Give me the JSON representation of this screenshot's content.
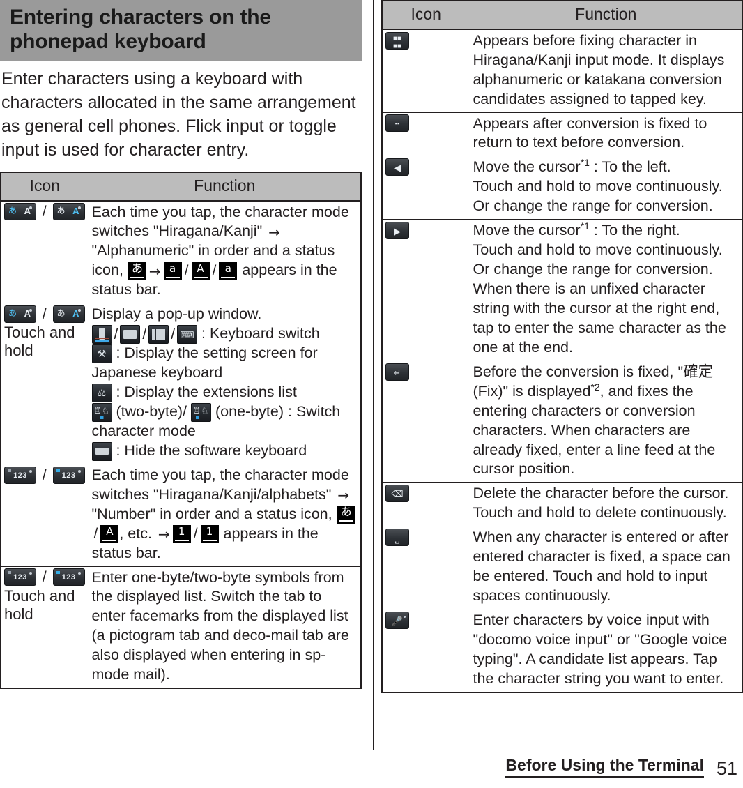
{
  "heading": "Entering characters on the phonepad keyboard",
  "intro": "Enter characters using a keyboard with characters allocated in the same arrangement as general cell phones. Flick input or toggle input is used for character entry.",
  "table_headers": {
    "icon": "Icon",
    "function": "Function"
  },
  "left_table": {
    "rows": [
      {
        "icon_label": "character-mode-key",
        "touch_and_hold": "",
        "text_1": "Each time you tap, the character mode switches \"Hiragana/Kanji\" ",
        "arrow_1": "→",
        "text_2": " \"Alphanumeric\" in order and a status icon, ",
        "status_1": "あ",
        "arrow_2": "→",
        "status_2": "a",
        "sep_1": "/",
        "status_3": "A",
        "sep_2": "/",
        "status_4": "a",
        "text_3": " appears in the status bar."
      },
      {
        "icon_label": "character-mode-key",
        "touch_and_hold": "Touch and hold",
        "line_1": "Display a pop-up window.",
        "line_2_suffix": ": Keyboard switch",
        "line_3_suffix": ": Display the setting screen for Japanese keyboard",
        "line_4_suffix": ": Display the extensions list",
        "line_5_a": "(two-byte)/",
        "line_5_b": "(one-byte) : Switch character mode",
        "line_6_suffix": ": Hide the software keyboard"
      },
      {
        "icon_label": "number-mode-key",
        "touch_and_hold": "",
        "text_1": "Each time you tap, the character mode switches \"Hiragana/Kanji/alphabets\" ",
        "arrow_1": "→",
        "text_2": " \"Number\" in order and a status icon, ",
        "status_1": "あ",
        "sep_1": "/",
        "status_2": "A",
        "text_3": ", etc. ",
        "arrow_2": "→",
        "status_3": "1",
        "sep_2": "/",
        "status_4": "1",
        "text_4": " appears in the status bar."
      },
      {
        "icon_label": "number-mode-key",
        "touch_and_hold": "Touch and hold",
        "text_1": "Enter one-byte/two-byte symbols from the displayed list. Switch the tab to enter facemarks from the displayed list (a pictogram tab and deco-mail tab are also displayed when entering in sp-mode mail)."
      }
    ]
  },
  "right_table": {
    "rows": [
      {
        "icon_label": "conversion-candidates-key",
        "text": "Appears before fixing character in Hiragana/Kanji input mode. It displays alphanumeric or katakana conversion candidates assigned to tapped key."
      },
      {
        "icon_label": "undo-conversion-key",
        "text": "Appears after conversion is fixed to return to text before conversion."
      },
      {
        "icon_label": "cursor-left-key",
        "line_1_a": "Move the cursor",
        "line_1_fn": "*1",
        "line_1_b": " : To the left.",
        "line_2": "Touch and hold to move continuously.",
        "line_3": "Or change the range for conversion."
      },
      {
        "icon_label": "cursor-right-key",
        "line_1_a": "Move the cursor",
        "line_1_fn": "*1",
        "line_1_b": " : To the right.",
        "line_2": "Touch and hold to move continuously.",
        "line_3": "Or change the range for conversion. When there is an unfixed character string with the cursor at the right end, tap to enter the same character as the one at the end."
      },
      {
        "icon_label": "enter-key",
        "line_1_a": "Before the conversion is fixed, \"",
        "line_1_jp": "確定",
        "line_1_b": " (Fix)\" is displayed",
        "line_1_fn": "*2",
        "line_1_c": ", and fixes the entering characters or conversion characters. When characters are already fixed, enter a line feed at the cursor position."
      },
      {
        "icon_label": "backspace-key",
        "text": "Delete the character before the cursor. Touch and hold to delete continuously."
      },
      {
        "icon_label": "space-key",
        "text": "When any character is entered or after entered character is fixed, a space can be entered. Touch and hold to input spaces continuously."
      },
      {
        "icon_label": "voice-input-key",
        "text": "Enter characters by voice input with \"docomo voice input\" or \"Google voice typing\". A candidate list appears. Tap the character string you want to enter."
      }
    ]
  },
  "footer": {
    "section_title": "Before Using the Terminal",
    "page_number": "51"
  },
  "colors": {
    "heading_band": "#9a9a9a",
    "table_header": "#bcbcbc",
    "rule": "#231f20",
    "key_accent": "#4fc3f7"
  }
}
